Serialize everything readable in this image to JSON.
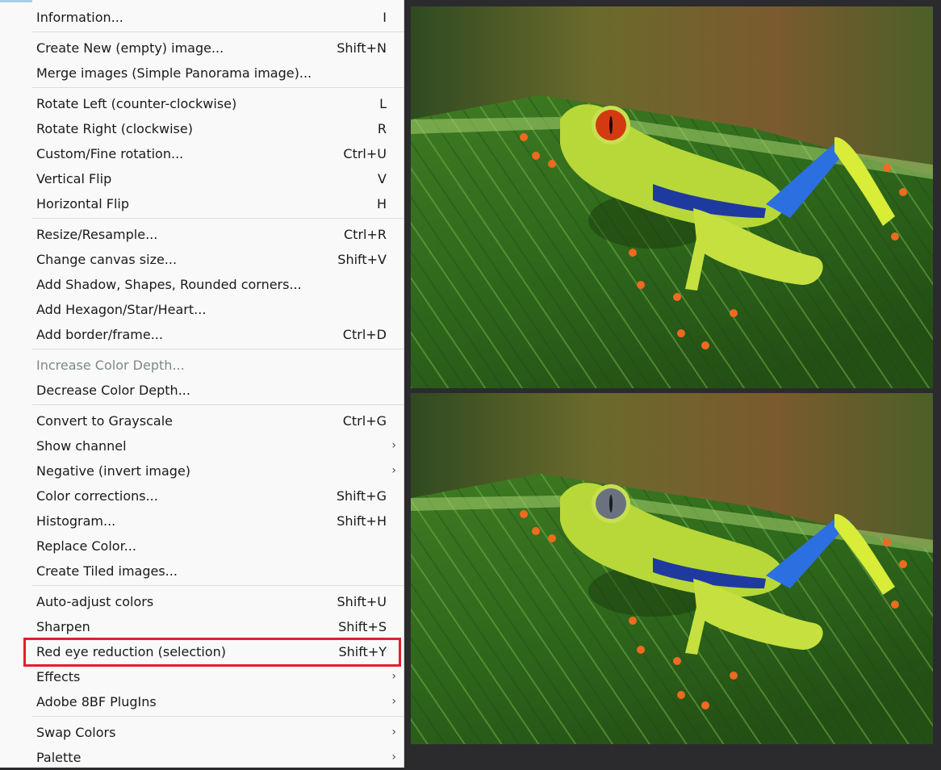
{
  "menu": {
    "items": [
      {
        "label": "Information...",
        "shortcut": "I",
        "arrow": ""
      },
      {
        "label": "Create New (empty) image...",
        "shortcut": "Shift+N",
        "arrow": ""
      },
      {
        "label": "Merge images (Simple Panorama image)...",
        "shortcut": "",
        "arrow": ""
      },
      {
        "label": "Rotate Left (counter-clockwise)",
        "shortcut": "L",
        "arrow": ""
      },
      {
        "label": "Rotate Right (clockwise)",
        "shortcut": "R",
        "arrow": ""
      },
      {
        "label": "Custom/Fine rotation...",
        "shortcut": "Ctrl+U",
        "arrow": ""
      },
      {
        "label": "Vertical Flip",
        "shortcut": "V",
        "arrow": ""
      },
      {
        "label": "Horizontal Flip",
        "shortcut": "H",
        "arrow": ""
      },
      {
        "label": "Resize/Resample...",
        "shortcut": "Ctrl+R",
        "arrow": ""
      },
      {
        "label": "Change canvas size...",
        "shortcut": "Shift+V",
        "arrow": ""
      },
      {
        "label": "Add Shadow, Shapes, Rounded corners...",
        "shortcut": "",
        "arrow": ""
      },
      {
        "label": "Add Hexagon/Star/Heart...",
        "shortcut": "",
        "arrow": ""
      },
      {
        "label": "Add border/frame...",
        "shortcut": "Ctrl+D",
        "arrow": ""
      },
      {
        "label": "Increase Color Depth...",
        "shortcut": "",
        "arrow": "",
        "disabled": true
      },
      {
        "label": "Decrease Color Depth...",
        "shortcut": "",
        "arrow": ""
      },
      {
        "label": "Convert to Grayscale",
        "shortcut": "Ctrl+G",
        "arrow": ""
      },
      {
        "label": "Show channel",
        "shortcut": "",
        "arrow": "›"
      },
      {
        "label": "Negative (invert image)",
        "shortcut": "",
        "arrow": "›"
      },
      {
        "label": "Color corrections...",
        "shortcut": "Shift+G",
        "arrow": ""
      },
      {
        "label": "Histogram...",
        "shortcut": "Shift+H",
        "arrow": ""
      },
      {
        "label": "Replace Color...",
        "shortcut": "",
        "arrow": ""
      },
      {
        "label": "Create Tiled images...",
        "shortcut": "",
        "arrow": ""
      },
      {
        "label": "Auto-adjust colors",
        "shortcut": "Shift+U",
        "arrow": ""
      },
      {
        "label": "Sharpen",
        "shortcut": "Shift+S",
        "arrow": ""
      },
      {
        "label": "Red eye reduction (selection)",
        "shortcut": "Shift+Y",
        "arrow": "",
        "highlighted": true
      },
      {
        "label": "Effects",
        "shortcut": "",
        "arrow": "›"
      },
      {
        "label": "Adobe 8BF PlugIns",
        "shortcut": "",
        "arrow": "›"
      },
      {
        "label": "Swap Colors",
        "shortcut": "",
        "arrow": "›"
      },
      {
        "label": "Palette",
        "shortcut": "",
        "arrow": "›"
      }
    ]
  },
  "preview": {
    "before_eye_color": "#d33a12",
    "after_eye_color": "#6a7280",
    "highlight_color": "#e0202e"
  }
}
